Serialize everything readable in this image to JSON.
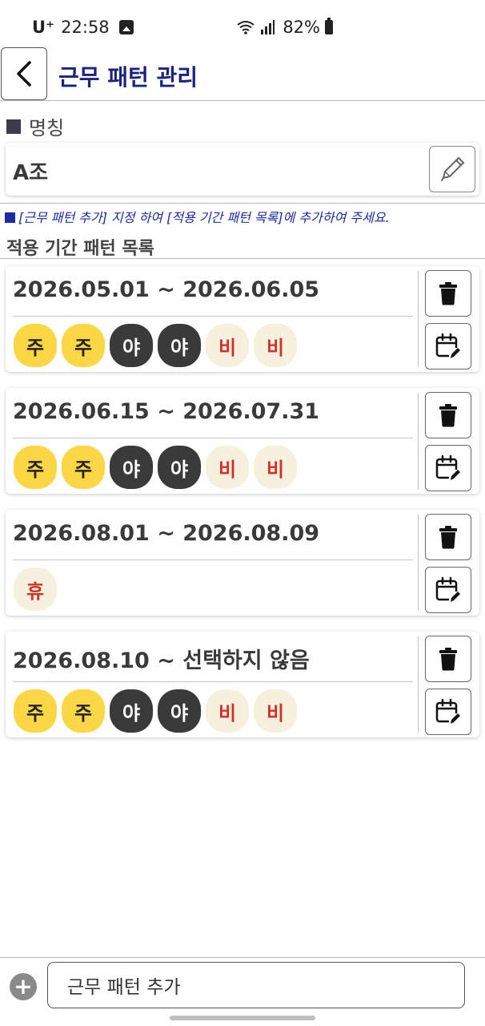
{
  "status_bar": {
    "carrier": "U⁺",
    "time": "22:58",
    "battery_percent": "82%",
    "icons": [
      "gallery-icon",
      "wifi-icon",
      "signal-icon",
      "battery-icon"
    ]
  },
  "header": {
    "title": "근무 패턴 관리",
    "back_icon": "chevron-left-icon"
  },
  "name_section": {
    "label": "명칭",
    "value": "A조",
    "edit_icon": "pencil-icon"
  },
  "hint": "[근무 패턴 추가] 지정 하여 [적용 기간 패턴 목록]에 추가하여 주세요.",
  "list_title": "적용 기간 패턴 목록",
  "patterns": [
    {
      "range": "2026.05.01 ~ 2026.06.05",
      "chips": [
        {
          "label": "주",
          "kind": "day"
        },
        {
          "label": "주",
          "kind": "day"
        },
        {
          "label": "야",
          "kind": "night"
        },
        {
          "label": "야",
          "kind": "night"
        },
        {
          "label": "비",
          "kind": "off"
        },
        {
          "label": "비",
          "kind": "off"
        }
      ]
    },
    {
      "range": "2026.06.15 ~ 2026.07.31",
      "chips": [
        {
          "label": "주",
          "kind": "day"
        },
        {
          "label": "주",
          "kind": "day"
        },
        {
          "label": "야",
          "kind": "night"
        },
        {
          "label": "야",
          "kind": "night"
        },
        {
          "label": "비",
          "kind": "off"
        },
        {
          "label": "비",
          "kind": "off"
        }
      ]
    },
    {
      "range": "2026.08.01 ~ 2026.08.09",
      "chips": [
        {
          "label": "휴",
          "kind": "rest"
        }
      ]
    },
    {
      "range": "2026.08.10 ~ 선택하지 않음",
      "chips": [
        {
          "label": "주",
          "kind": "day"
        },
        {
          "label": "주",
          "kind": "day"
        },
        {
          "label": "야",
          "kind": "night"
        },
        {
          "label": "야",
          "kind": "night"
        },
        {
          "label": "비",
          "kind": "off"
        },
        {
          "label": "비",
          "kind": "off"
        }
      ]
    }
  ],
  "card_actions": {
    "delete_icon": "trash-icon",
    "calendar_icon": "calendar-edit-icon"
  },
  "bottom_bar": {
    "add_label": "근무 패턴 추가",
    "add_icon": "plus-circle-icon"
  },
  "colors": {
    "title": "#1a237e",
    "hint": "#1a2aa8",
    "day_chip": "#fbd745",
    "night_chip": "#3a3a3a",
    "off_chip_bg": "#f5f1dc",
    "off_chip_text": "#d0312d"
  }
}
